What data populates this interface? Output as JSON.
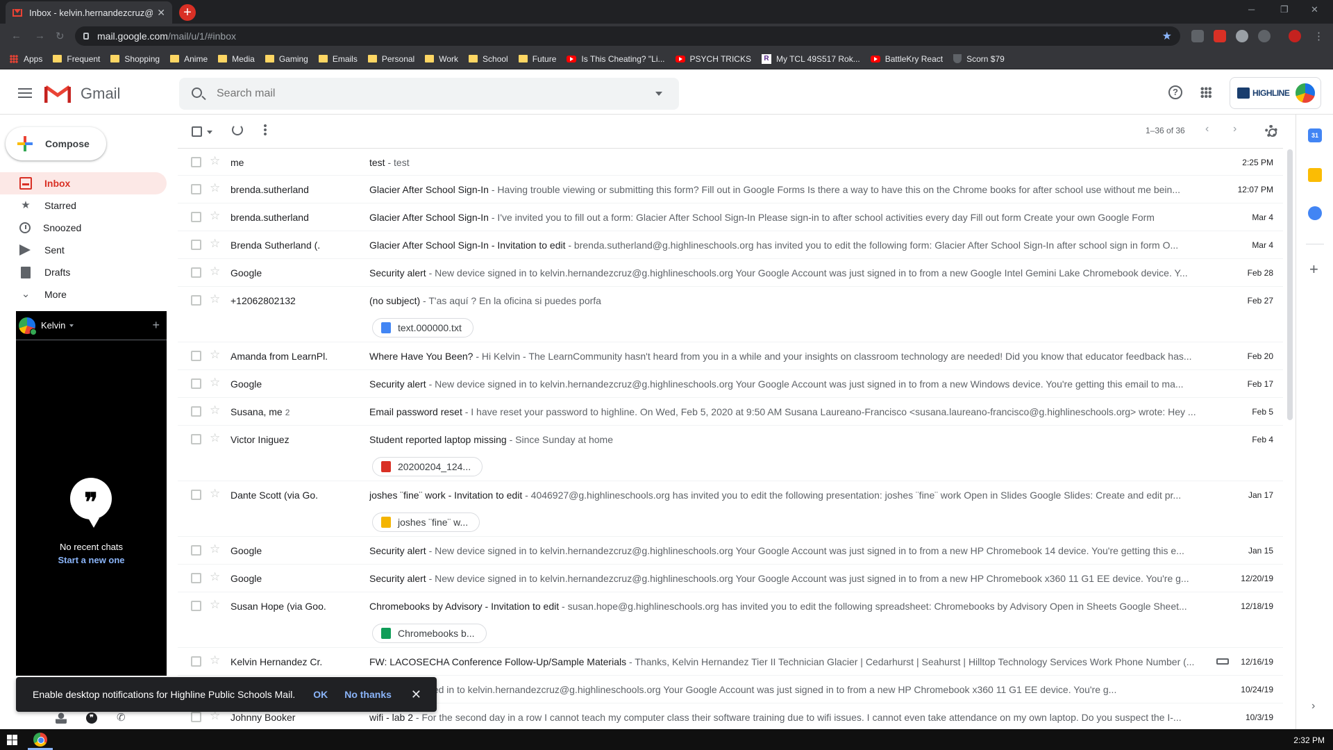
{
  "browser": {
    "tab_title": "Inbox - kelvin.hernandezcruz@g",
    "url_host": "mail.google.com",
    "url_path": "/mail/u/1/#inbox",
    "bookmarks": [
      {
        "label": "Apps",
        "icon": "apps-icon"
      },
      {
        "label": "Frequent",
        "icon": "folder-icon"
      },
      {
        "label": "Shopping",
        "icon": "folder-icon"
      },
      {
        "label": "Anime",
        "icon": "folder-icon"
      },
      {
        "label": "Media",
        "icon": "folder-icon"
      },
      {
        "label": "Gaming",
        "icon": "folder-icon"
      },
      {
        "label": "Emails",
        "icon": "folder-icon"
      },
      {
        "label": "Personal",
        "icon": "folder-icon"
      },
      {
        "label": "Work",
        "icon": "folder-icon"
      },
      {
        "label": "School",
        "icon": "folder-icon"
      },
      {
        "label": "Future",
        "icon": "folder-icon"
      },
      {
        "label": "Is This Cheating? \"Li...",
        "icon": "youtube-icon"
      },
      {
        "label": "PSYCH TRICKS",
        "icon": "youtube-icon"
      },
      {
        "label": "My TCL 49S517 Rok...",
        "icon": "roku-icon"
      },
      {
        "label": "BattleKry React",
        "icon": "youtube-icon"
      },
      {
        "label": "Scorn $79",
        "icon": "shield-icon"
      }
    ]
  },
  "header": {
    "app_name": "Gmail",
    "search_placeholder": "Search mail",
    "org_name": "HIGHLINE"
  },
  "nav": {
    "compose_label": "Compose",
    "items": [
      {
        "label": "Inbox",
        "icon": "inbox-icon",
        "active": true
      },
      {
        "label": "Starred",
        "icon": "star-icon"
      },
      {
        "label": "Snoozed",
        "icon": "clock-icon"
      },
      {
        "label": "Sent",
        "icon": "send-icon"
      },
      {
        "label": "Drafts",
        "icon": "draft-icon"
      },
      {
        "label": "More",
        "icon": "chevron-down-icon"
      }
    ]
  },
  "hangouts": {
    "user_name": "Kelvin",
    "empty_text": "No recent chats",
    "start_link": "Start a new one"
  },
  "list": {
    "range": "1–36 of 36",
    "emails": [
      {
        "sender": "me",
        "count": "",
        "subject": "test",
        "snippet": " - test",
        "date": "2:25 PM"
      },
      {
        "sender": "brenda.sutherland",
        "count": "",
        "subject": "Glacier After School Sign-In",
        "snippet": " - Having trouble viewing or submitting this form? Fill out in Google Forms Is there a way to have this on the Chrome books for after school use without me bein...",
        "date": "12:07 PM"
      },
      {
        "sender": "brenda.sutherland",
        "count": "",
        "subject": "Glacier After School Sign-In",
        "snippet": " - I've invited you to fill out a form: Glacier After School Sign-In Please sign-in to after school activities every day Fill out form Create your own Google Form",
        "date": "Mar 4"
      },
      {
        "sender": "Brenda Sutherland (.",
        "count": "",
        "subject": "Glacier After School Sign-In - Invitation to edit",
        "snippet": " - brenda.sutherland@g.highlineschools.org has invited you to edit the following form: Glacier After School Sign-In after school sign in form O...",
        "date": "Mar 4"
      },
      {
        "sender": "Google",
        "count": "",
        "subject": "Security alert",
        "snippet": " - New device signed in to kelvin.hernandezcruz@g.highlineschools.org Your Google Account was just signed in to from a new Google Intel Gemini Lake Chromebook device. Y...",
        "date": "Feb 28"
      },
      {
        "sender": "+12062802132",
        "count": "",
        "subject": "(no subject)",
        "snippet": " - T'as aquí ? En la oficina si puedes porfa",
        "date": "Feb 27",
        "attachment": {
          "name": "text.000000.txt",
          "type": "doc"
        }
      },
      {
        "sender": "Amanda from LearnPl.",
        "count": "",
        "subject": "Where Have You Been?",
        "snippet": " - Hi Kelvin - The LearnCommunity hasn't heard from you in a while and your insights on classroom technology are needed! Did you know that educator feedback has...",
        "date": "Feb 20"
      },
      {
        "sender": "Google",
        "count": "",
        "subject": "Security alert",
        "snippet": " - New device signed in to kelvin.hernandezcruz@g.highlineschools.org Your Google Account was just signed in to from a new Windows device. You're getting this email to ma...",
        "date": "Feb 17"
      },
      {
        "sender": "Susana, me",
        "count": "2",
        "subject": "Email password reset",
        "snippet": " - I have reset your password to highline. On Wed, Feb 5, 2020 at 9:50 AM Susana Laureano-Francisco <susana.laureano-francisco@g.highlineschools.org> wrote: Hey ...",
        "date": "Feb 5"
      },
      {
        "sender": "Victor Iniguez",
        "count": "",
        "subject": "Student reported laptop missing",
        "snippet": " - Since Sunday at home",
        "date": "Feb 4",
        "attachment": {
          "name": "20200204_124...",
          "type": "img"
        }
      },
      {
        "sender": "Dante Scott (via Go.",
        "count": "",
        "subject": "joshes ¨fine¨ work - Invitation to edit",
        "snippet": " - 4046927@g.highlineschools.org has invited you to edit the following presentation: joshes ¨fine¨ work Open in Slides Google Slides: Create and edit pr...",
        "date": "Jan 17",
        "attachment": {
          "name": "joshes ¨fine¨ w...",
          "type": "slides"
        }
      },
      {
        "sender": "Google",
        "count": "",
        "subject": "Security alert",
        "snippet": " - New device signed in to kelvin.hernandezcruz@g.highlineschools.org Your Google Account was just signed in to from a new HP Chromebook 14 device. You're getting this e...",
        "date": "Jan 15"
      },
      {
        "sender": "Google",
        "count": "",
        "subject": "Security alert",
        "snippet": " - New device signed in to kelvin.hernandezcruz@g.highlineschools.org Your Google Account was just signed in to from a new HP Chromebook x360 11 G1 EE device. You're g...",
        "date": "12/20/19"
      },
      {
        "sender": "Susan Hope (via Goo.",
        "count": "",
        "subject": "Chromebooks by Advisory - Invitation to edit",
        "snippet": " - susan.hope@g.highlineschools.org has invited you to edit the following spreadsheet: Chromebooks by Advisory Open in Sheets Google Sheet...",
        "date": "12/18/19",
        "attachment": {
          "name": "Chromebooks b...",
          "type": "sheets"
        }
      },
      {
        "sender": "Kelvin Hernandez Cr.",
        "count": "",
        "subject": "FW: LACOSECHA Conference Follow-Up/Sample Materials",
        "snippet": " - Thanks, Kelvin Hernandez Tier II Technician Glacier | Cedarhurst | Seahurst | Hilltop Technology Services Work Phone Number (...",
        "date": "12/16/19",
        "label_icon": true
      },
      {
        "sender": "",
        "count": "",
        "subject": "",
        "snippet": "ew device signed in to kelvin.hernandezcruz@g.highlineschools.org Your Google Account was just signed in to from a new HP Chromebook x360 11 G1 EE device. You're g...",
        "date": "10/24/19"
      },
      {
        "sender": "Johnny Booker",
        "count": "",
        "subject": "wifi - lab 2",
        "snippet": " - For the second day in a row I cannot teach my computer class their software training due to wifi issues. I cannot even take attendance on my own laptop. Do you suspect the I-...",
        "date": "10/3/19"
      }
    ]
  },
  "toast": {
    "message": "Enable desktop notifications for Highline Public Schools Mail.",
    "ok_label": "OK",
    "no_label": "No thanks"
  },
  "sidepanel": {
    "calendar_day": "31"
  },
  "taskbar": {
    "time": "2:32 PM"
  }
}
